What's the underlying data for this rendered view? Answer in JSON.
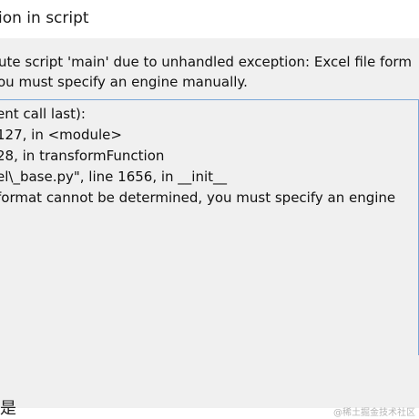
{
  "window": {
    "title": "ion in script"
  },
  "message": {
    "line1": "ute script 'main' due to unhandled exception: Excel file form",
    "line2": "ou must specify an engine manually."
  },
  "traceback": {
    "lines": [
      "ent call last):",
      "127, in <module>",
      "28, in transformFunction",
      "el\\_base.py\", line 1656, in __init__",
      " format cannot be determined, you must specify an engine"
    ]
  },
  "footer": {
    "partial_glyph": "是"
  },
  "watermark": {
    "text": "@稀土掘金技术社区"
  }
}
